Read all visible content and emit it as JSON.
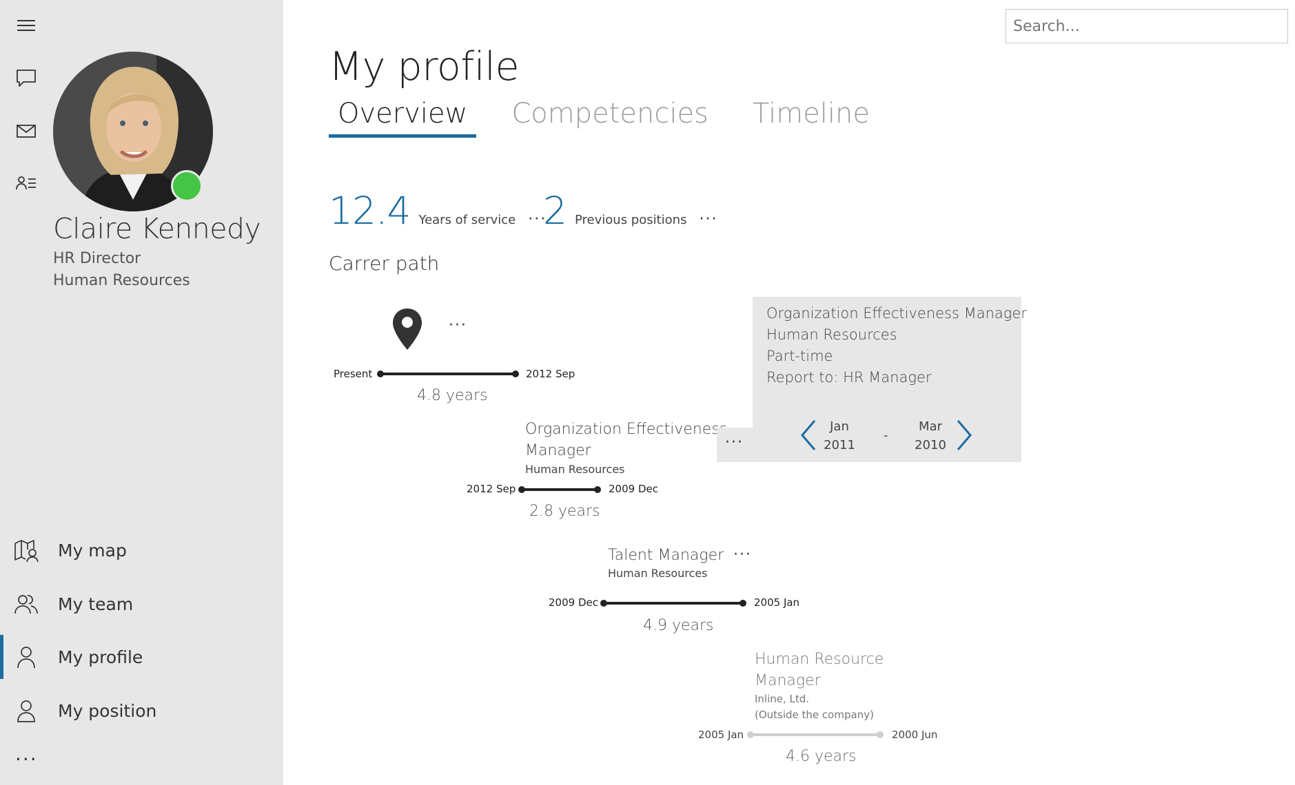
{
  "sidebar": {
    "rail_icons": [
      "hamburger-icon",
      "chat-icon",
      "mail-icon",
      "contact-list-icon"
    ],
    "profile": {
      "name": "Claire Kennedy",
      "role": "HR Director",
      "department": "Human Resources",
      "presence_color": "#45c546"
    },
    "nav": [
      {
        "label": "My map",
        "icon": "map-person-icon",
        "active": false
      },
      {
        "label": "My team",
        "icon": "team-icon",
        "active": false
      },
      {
        "label": "My profile",
        "icon": "person-icon",
        "active": true
      },
      {
        "label": "My position",
        "icon": "person-icon",
        "active": false
      }
    ],
    "more": "···"
  },
  "search": {
    "placeholder": "Search..."
  },
  "main": {
    "title": "My profile",
    "tabs": [
      {
        "label": "Overview",
        "active": true
      },
      {
        "label": "Competencies",
        "active": false
      },
      {
        "label": "Timeline",
        "active": false
      }
    ],
    "stats": [
      {
        "value": "12.4",
        "label": "Years of service",
        "more": "···"
      },
      {
        "value": "2",
        "label": "Previous positions",
        "more": "···"
      }
    ],
    "career_title": "Carrer path",
    "current": {
      "more": "···",
      "start_label": "Present",
      "end_label": "2012 Sep",
      "duration": "4.8 years"
    },
    "positions": [
      {
        "title_line1": "Organization Effectiveness",
        "title_line2": "Manager",
        "department": "Human Resources",
        "from": "2012 Sep",
        "to": "2009 Dec",
        "duration": "2.8 years",
        "more": "···"
      },
      {
        "title_line1": "Talent Manager",
        "department": "Human Resources",
        "from": "2009 Dec",
        "to": "2005 Jan",
        "duration": "4.9 years",
        "more": "···"
      },
      {
        "title_line1": "Human Resource",
        "title_line2": "Manager",
        "department": "Inline, Ltd.",
        "note": "(Outside the company)",
        "from": "2005 Jan",
        "to": "2000 Jun",
        "duration": "4.6 years"
      }
    ],
    "popup": {
      "lines": [
        "Organization Effectiveness Manager",
        "Human Resources",
        "Part-time",
        "Report to: HR Manager"
      ],
      "from_month": "Jan",
      "from_year": "2011",
      "to_month": "Mar",
      "to_year": "2010",
      "dash": "-"
    }
  },
  "colors": {
    "accent": "#1b6ca1",
    "sidebar_bg": "#e7e7e7"
  }
}
